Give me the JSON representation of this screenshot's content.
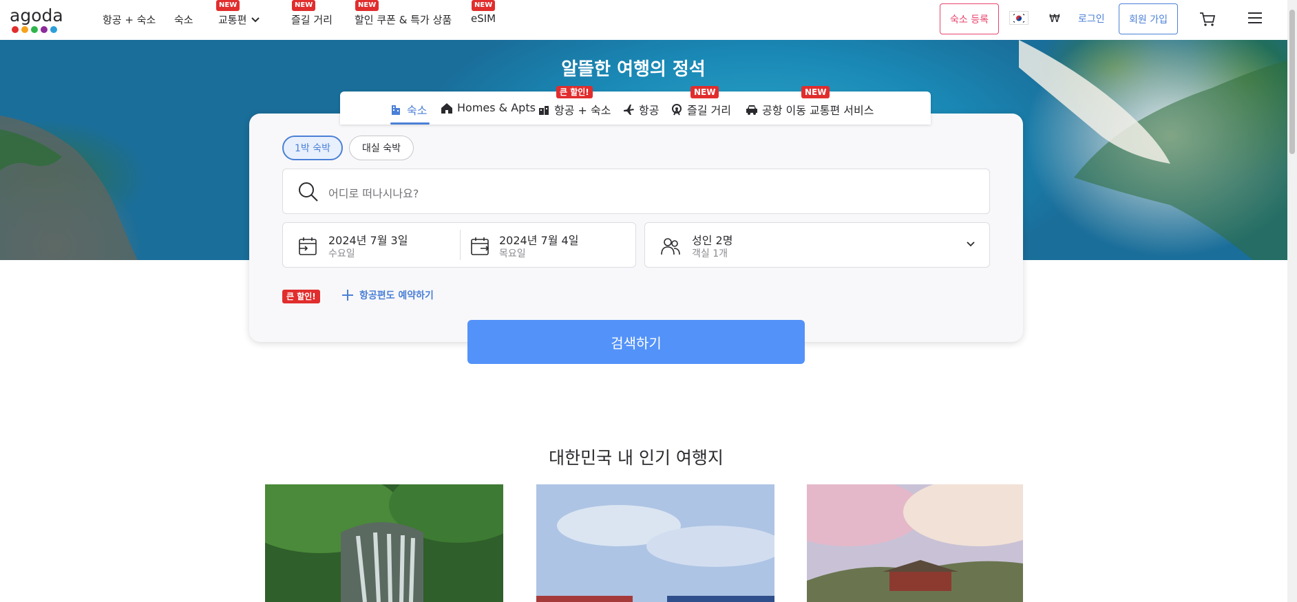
{
  "header": {
    "logo_text": "agoda",
    "logo_dot_colors": [
      "#e12d2d",
      "#f7a21b",
      "#31b44b",
      "#8c2a9b",
      "#2b9fd9"
    ],
    "nav": [
      {
        "label": "항공 + 숙소",
        "badge": ""
      },
      {
        "label": "숙소",
        "badge": ""
      },
      {
        "label": "교통편",
        "badge": "NEW"
      },
      {
        "label": "즐길 거리",
        "badge": "NEW"
      },
      {
        "label": "할인 쿠폰 & 특가 상품",
        "badge": "NEW"
      },
      {
        "label": "eSIM",
        "badge": "NEW"
      }
    ],
    "list_property": "숙소 등록",
    "currency": "₩",
    "login": "로그인",
    "signup": "회원 가입"
  },
  "hero": {
    "title": "알뜰한 여행의 정석"
  },
  "tabs": [
    {
      "label": "숙소",
      "icon": "hotel-icon",
      "badge": ""
    },
    {
      "label": "Homes & Apts",
      "icon": "home-icon",
      "badge": ""
    },
    {
      "label": "항공 + 숙소",
      "icon": "flight-hotel-icon",
      "badge": "큰 할인!"
    },
    {
      "label": "항공",
      "icon": "plane-icon",
      "badge": ""
    },
    {
      "label": "즐길 거리",
      "icon": "ferris-wheel-icon",
      "badge": "NEW"
    },
    {
      "label": "공항 이동 교통편 서비스",
      "icon": "car-icon",
      "badge": "NEW"
    }
  ],
  "search": {
    "stay_types": [
      "1박 숙박",
      "대실 숙박"
    ],
    "placeholder": "어디로 떠나시나요?",
    "checkin_date": "2024년 7월 3일",
    "checkin_day": "수요일",
    "checkout_date": "2024년 7월 4일",
    "checkout_day": "목요일",
    "guests": "성인 2명",
    "rooms": "객실 1개",
    "promo_badge": "큰 할인!",
    "add_flight": "항공편도 예약하기",
    "submit": "검색하기"
  },
  "section": {
    "title": "대한민국 내 인기 여행지"
  },
  "colors": {
    "accent": "#5392f9",
    "badge_red": "#e12d2d",
    "register_pink": "#e8426b"
  }
}
